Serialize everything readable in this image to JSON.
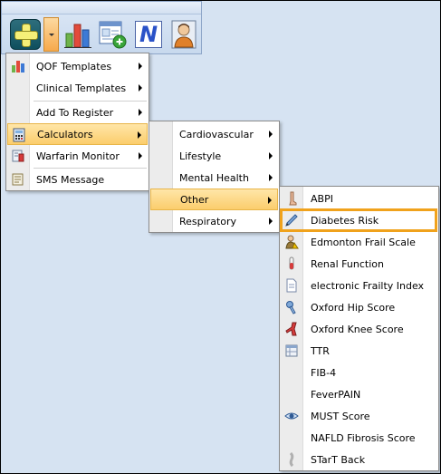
{
  "toolbar": {
    "buttons": [
      {
        "name": "add-button",
        "icon": "plus-icon"
      },
      {
        "name": "dropdown-button",
        "icon": "chevron-down-icon"
      },
      {
        "name": "reports-button",
        "icon": "bar-chart-icon"
      },
      {
        "name": "form-add-button",
        "icon": "form-add-icon"
      },
      {
        "name": "n-button",
        "icon": "n-logo-icon",
        "text": "N"
      },
      {
        "name": "patient-button",
        "icon": "person-icon"
      }
    ]
  },
  "menu1": {
    "items": [
      {
        "label": "QOF Templates",
        "icon": "bar-chart-icon",
        "submenu": true
      },
      {
        "label": "Clinical Templates",
        "icon": "",
        "submenu": true
      },
      {
        "label": "Add To Register",
        "icon": "",
        "submenu": true
      },
      {
        "label": "Calculators",
        "icon": "calculator-icon",
        "submenu": true,
        "highlighted": true
      },
      {
        "label": "Warfarin Monitor",
        "icon": "warfarin-icon",
        "submenu": true
      },
      {
        "label": "SMS Message",
        "icon": "sms-icon",
        "submenu": false
      }
    ]
  },
  "menu2": {
    "items": [
      {
        "label": "Cardiovascular",
        "submenu": true
      },
      {
        "label": "Lifestyle",
        "submenu": true
      },
      {
        "label": "Mental Health",
        "submenu": true
      },
      {
        "label": "Other",
        "submenu": true,
        "highlighted": true
      },
      {
        "label": "Respiratory",
        "submenu": true
      }
    ]
  },
  "menu3": {
    "items": [
      {
        "label": "ABPI",
        "icon": "leg-icon"
      },
      {
        "label": "Diabetes Risk",
        "icon": "pen-icon",
        "focused": true
      },
      {
        "label": "Edmonton Frail Scale",
        "icon": "elderly-icon"
      },
      {
        "label": "Renal Function",
        "icon": "test-tube-icon"
      },
      {
        "label": "electronic Frailty Index",
        "icon": "document-icon"
      },
      {
        "label": "Oxford Hip Score",
        "icon": "hip-icon"
      },
      {
        "label": "Oxford Knee Score",
        "icon": "knee-icon"
      },
      {
        "label": "TTR",
        "icon": "table-icon"
      },
      {
        "label": "FIB-4",
        "icon": ""
      },
      {
        "label": "FeverPAIN",
        "icon": ""
      },
      {
        "label": "MUST Score",
        "icon": "eye-icon"
      },
      {
        "label": "NAFLD Fibrosis Score",
        "icon": ""
      },
      {
        "label": "STarT Back",
        "icon": "spine-icon"
      }
    ]
  },
  "colors": {
    "highlight": "#fbcd6c",
    "focus": "#f0a21c",
    "background": "#d6e3f2"
  }
}
